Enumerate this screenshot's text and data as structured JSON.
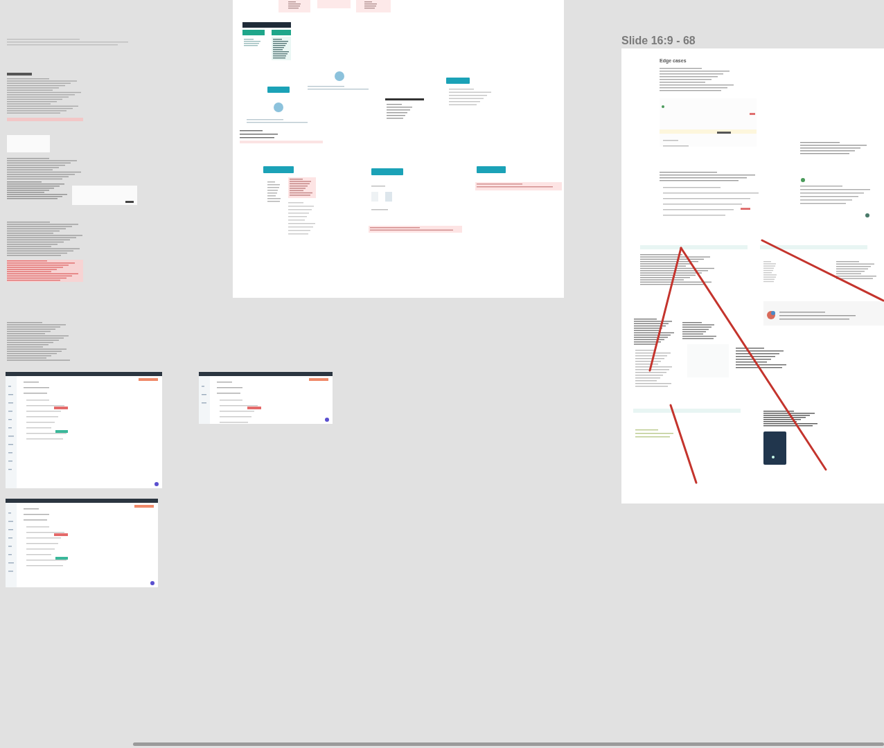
{
  "canvas": {
    "frames": [
      {
        "label": "Slide 16:9 - 68",
        "heading": "Edge cases"
      }
    ]
  }
}
